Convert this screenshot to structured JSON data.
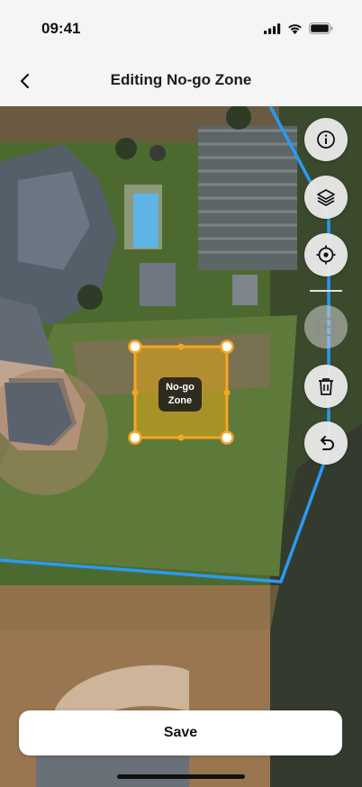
{
  "status_bar": {
    "time": "09:41"
  },
  "header": {
    "title": "Editing No-go Zone",
    "back_icon": "chevron-left-icon"
  },
  "map": {
    "type": "satellite",
    "boundary_color": "#2a9af3",
    "zone_color": "#f6a623",
    "zone": {
      "label_line1": "No-go",
      "label_line2": "Zone"
    }
  },
  "controls": {
    "info_icon": "info-icon",
    "layers_icon": "layers-icon",
    "locate_icon": "locate-icon",
    "add_icon": "add-square-icon",
    "delete_icon": "trash-icon",
    "undo_icon": "undo-icon"
  },
  "footer": {
    "save_label": "Save"
  }
}
